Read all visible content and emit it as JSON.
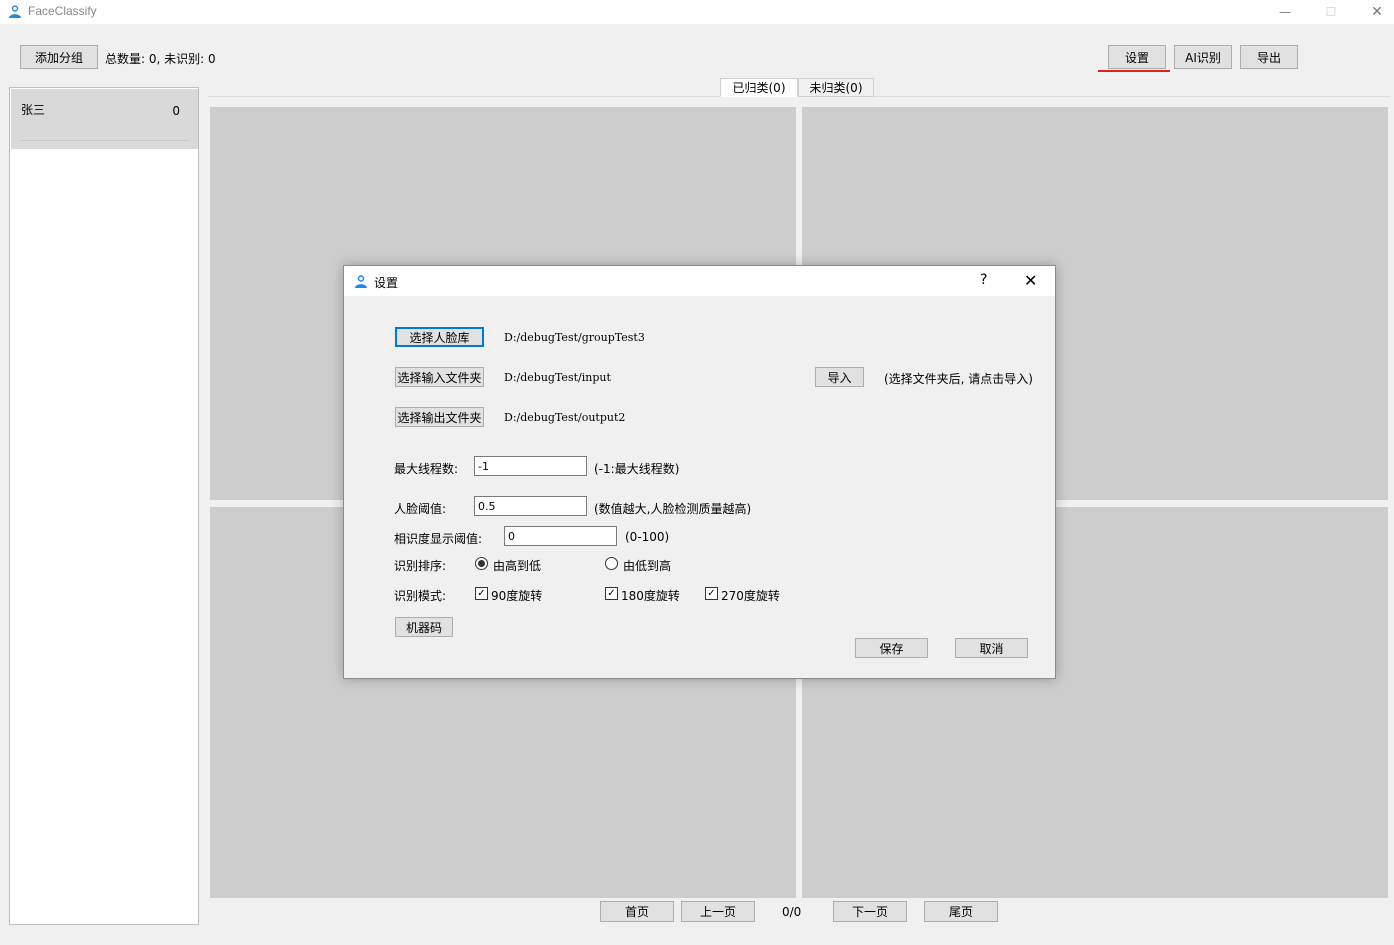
{
  "window": {
    "title": "FaceClassify",
    "min_glyph": "—",
    "max_glyph": "☐",
    "close_glyph": "✕"
  },
  "toolbar": {
    "add_group": "添加分组",
    "stats": "总数量: 0, 未识别: 0",
    "settings": "设置",
    "ai_recognize": "AI识别",
    "export": "导出"
  },
  "tabs": [
    {
      "label": "已归类(0)",
      "active": true
    },
    {
      "label": "未归类(0)",
      "active": false
    }
  ],
  "sidebar": {
    "groups": [
      {
        "name": "张三",
        "count": "0"
      }
    ]
  },
  "pager": {
    "first": "首页",
    "prev": "上一页",
    "info": "0/0",
    "next": "下一页",
    "last": "尾页"
  },
  "dialog": {
    "title": "设置",
    "help": "?",
    "close": "✕",
    "face_db_button": "选择人脸库",
    "face_db_path": "D:/debugTest/groupTest3",
    "input_button": "选择输入文件夹",
    "input_path": "D:/debugTest/input",
    "import_button": "导入",
    "import_hint": "(选择文件夹后, 请点击导入)",
    "output_button": "选择输出文件夹",
    "output_path": "D:/debugTest/output2",
    "max_threads_label": "最大线程数:",
    "max_threads_value": "-1",
    "max_threads_hint": "(-1:最大线程数)",
    "face_threshold_label": "人脸阈值:",
    "face_threshold_value": "0.5",
    "face_threshold_hint": "(数值越大,人脸检测质量越高)",
    "similarity_label": "相识度显示阈值:",
    "similarity_value": "0",
    "similarity_hint": "(0-100)",
    "sort_label": "识别排序:",
    "sort_options": [
      {
        "label": "由高到低",
        "checked": true
      },
      {
        "label": "由低到高",
        "checked": false
      }
    ],
    "mode_label": "识别模式:",
    "mode_options": [
      {
        "label": "90度旋转",
        "checked": true
      },
      {
        "label": "180度旋转",
        "checked": true
      },
      {
        "label": "270度旋转",
        "checked": true
      }
    ],
    "machine_code_button": "机器码",
    "save_button": "保存",
    "cancel_button": "取消"
  },
  "colors": {
    "accent_focus": "#0078d7",
    "highlight_underline": "#e02020",
    "icon_blue": "#1e88e5"
  }
}
